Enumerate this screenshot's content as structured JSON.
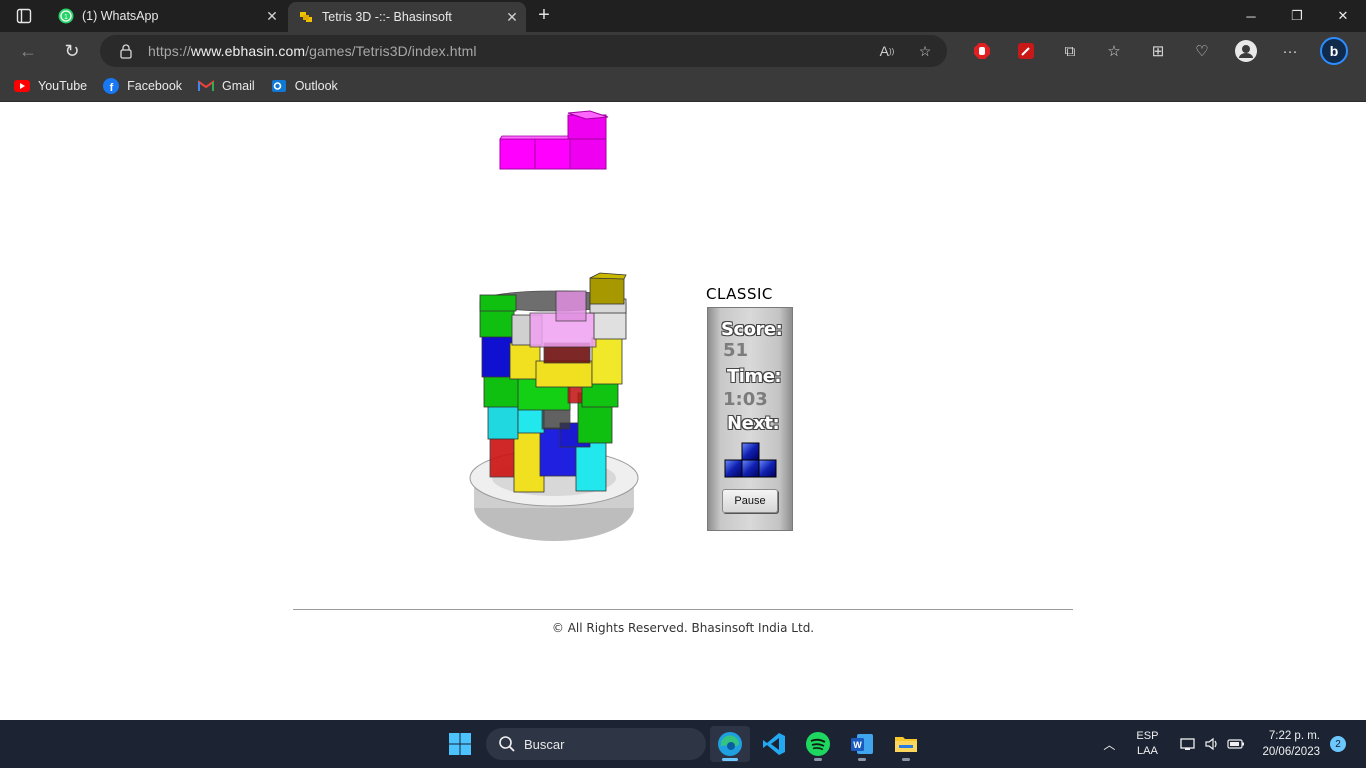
{
  "browser": {
    "tabs": [
      {
        "title": "(1) WhatsApp",
        "active": false,
        "favicon": "whatsapp-icon"
      },
      {
        "title": "Tetris 3D -::- Bhasinsoft",
        "active": true,
        "favicon": "tetris-icon"
      }
    ],
    "url_prefix": "https://",
    "url_host": "www.ebhasin.com",
    "url_path": "/games/Tetris3D/index.html",
    "bookmarks": [
      {
        "label": "YouTube",
        "icon": "youtube-icon"
      },
      {
        "label": "Facebook",
        "icon": "facebook-icon"
      },
      {
        "label": "Gmail",
        "icon": "gmail-icon"
      },
      {
        "label": "Outlook",
        "icon": "outlook-icon"
      }
    ]
  },
  "game": {
    "mode": "CLASSIC",
    "score_label": "Score:",
    "score": "51",
    "time_label": "Time:",
    "time": "1:03",
    "next_label": "Next:",
    "pause_label": "Pause",
    "falling_piece_color": "#ff00ff",
    "next_piece": "T"
  },
  "footer": {
    "copyright": "© All Rights Reserved. Bhasinsoft India Ltd."
  },
  "taskbar": {
    "search_placeholder": "Buscar",
    "lang_line1": "ESP",
    "lang_line2": "LAA",
    "time": "7:22 p. m.",
    "date": "20/06/2023",
    "notifications": "2",
    "apps": [
      "edge-icon",
      "vscode-icon",
      "spotify-icon",
      "word-icon",
      "file-explorer-icon"
    ]
  },
  "colors": {
    "accent": "#6cc7ff",
    "chrome_dark": "#202020",
    "toolbar": "#3a3a3a"
  }
}
